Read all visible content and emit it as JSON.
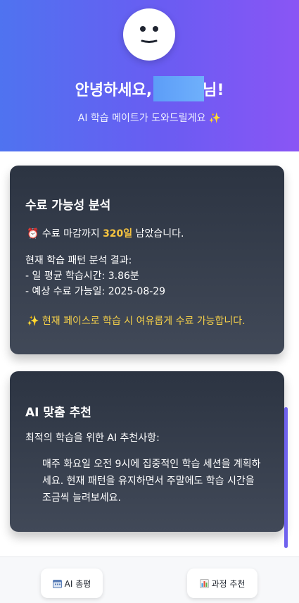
{
  "hero": {
    "greeting_prefix": "안녕하세요,",
    "greeting_suffix": "님!",
    "subtitle": "AI 학습 메이트가 도와드릴게요 ✨"
  },
  "completion": {
    "title": "수료 가능성 분석",
    "deadline_prefix": "⏰ 수료 마감까지 ",
    "deadline_days": "320일",
    "deadline_suffix": " 남았습니다.",
    "analysis_header": "현재 학습 패턴 분석 결과:",
    "avg_study_time": "- 일 평균 학습시간: 3.86분",
    "expected_date": "- 예상 수료 가능일: 2025-08-29",
    "notice": "✨ 현재 페이스로 학습 시 여유롭게 수료 가능합니다."
  },
  "recommendation": {
    "title": "AI 맞춤 추천",
    "intro": "최적의 학습을 위한 AI 추천사항:",
    "text": "매주 화요일 오전 9시에 집중적인 학습 세션을 계획하세요. 현재 패턴을 유지하면서 주말에도 학습 시간을 조금씩 늘려보세요."
  },
  "bottom_nav": {
    "ai_review_label": "AI 총평",
    "course_recommend_label": "과정 추천"
  },
  "icons": {
    "avatar": "smiley-face-icon",
    "ai_review": "calendar-icon",
    "course_recommend": "bar-chart-icon"
  },
  "colors": {
    "accent_yellow": "#f7c43f",
    "scroll_accent": "#6f62ee"
  }
}
